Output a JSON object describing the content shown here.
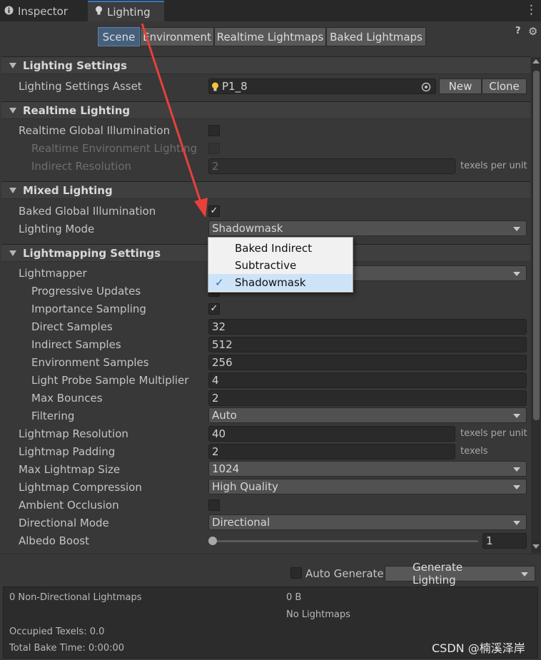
{
  "window_tabs": {
    "inspector": "Inspector",
    "lighting": "Lighting",
    "more": "⋮"
  },
  "sub_tabs": [
    "Scene",
    "Environment",
    "Realtime Lightmaps",
    "Baked Lightmaps"
  ],
  "help_glyph": "?",
  "settings_glyph": "⚙",
  "lighting_settings": {
    "header": "Lighting Settings",
    "asset_label": "Lighting Settings Asset",
    "asset_value": "P1_8",
    "new_button": "New",
    "clone_button": "Clone"
  },
  "realtime_lighting": {
    "header": "Realtime Lighting",
    "gi_label": "Realtime Global Illumination",
    "env_label": "Realtime Environment Lighting",
    "indirect_label": "Indirect Resolution",
    "indirect_value": "2",
    "indirect_unit": "texels per unit"
  },
  "mixed_lighting": {
    "header": "Mixed Lighting",
    "baked_gi_label": "Baked Global Illumination",
    "mode_label": "Lighting Mode",
    "mode_value": "Shadowmask",
    "baked_gi_check": "✓"
  },
  "mode_menu": {
    "items": [
      "Baked Indirect",
      "Subtractive",
      "Shadowmask"
    ],
    "selected_check": "✓"
  },
  "lightmapping": {
    "header": "Lightmapping Settings",
    "rows": {
      "lightmapper": "Lightmapper",
      "progressive": "Progressive Updates",
      "importance": "Importance Sampling",
      "direct": "Direct Samples",
      "indirect": "Indirect Samples",
      "environment": "Environment Samples",
      "probe_mult": "Light Probe Sample Multiplier",
      "bounces": "Max Bounces",
      "filtering": "Filtering",
      "resolution": "Lightmap Resolution",
      "padding": "Lightmap Padding",
      "max_size": "Max Lightmap Size",
      "compression": "Lightmap Compression",
      "ao": "Ambient Occlusion",
      "directional": "Directional Mode",
      "albedo": "Albedo Boost"
    },
    "values": {
      "importance_check": "✓",
      "direct": "32",
      "indirect": "512",
      "environment": "256",
      "probe_mult": "4",
      "bounces": "2",
      "filtering": "Auto",
      "resolution": "40",
      "resolution_unit": "texels per unit",
      "padding": "2",
      "padding_unit": "texels",
      "max_size": "1024",
      "compression": "High Quality",
      "directional": "Directional",
      "albedo": "1"
    },
    "albedo_slider_fraction": 0.0
  },
  "generate": {
    "auto_label": "Auto Generate",
    "button": "Generate Lighting"
  },
  "stats": {
    "non_directional": "0 Non-Directional Lightmaps",
    "size": "0 B",
    "no_lightmaps": "No Lightmaps",
    "occupied": "Occupied Texels: 0.0",
    "bake_time": "Total Bake Time: 0:00:00"
  },
  "watermark": "CSDN @楠溪泽岸",
  "colors": {
    "accent": "#46607c",
    "arrow": "#e8403a",
    "menu_selected": "#cde3f7"
  }
}
